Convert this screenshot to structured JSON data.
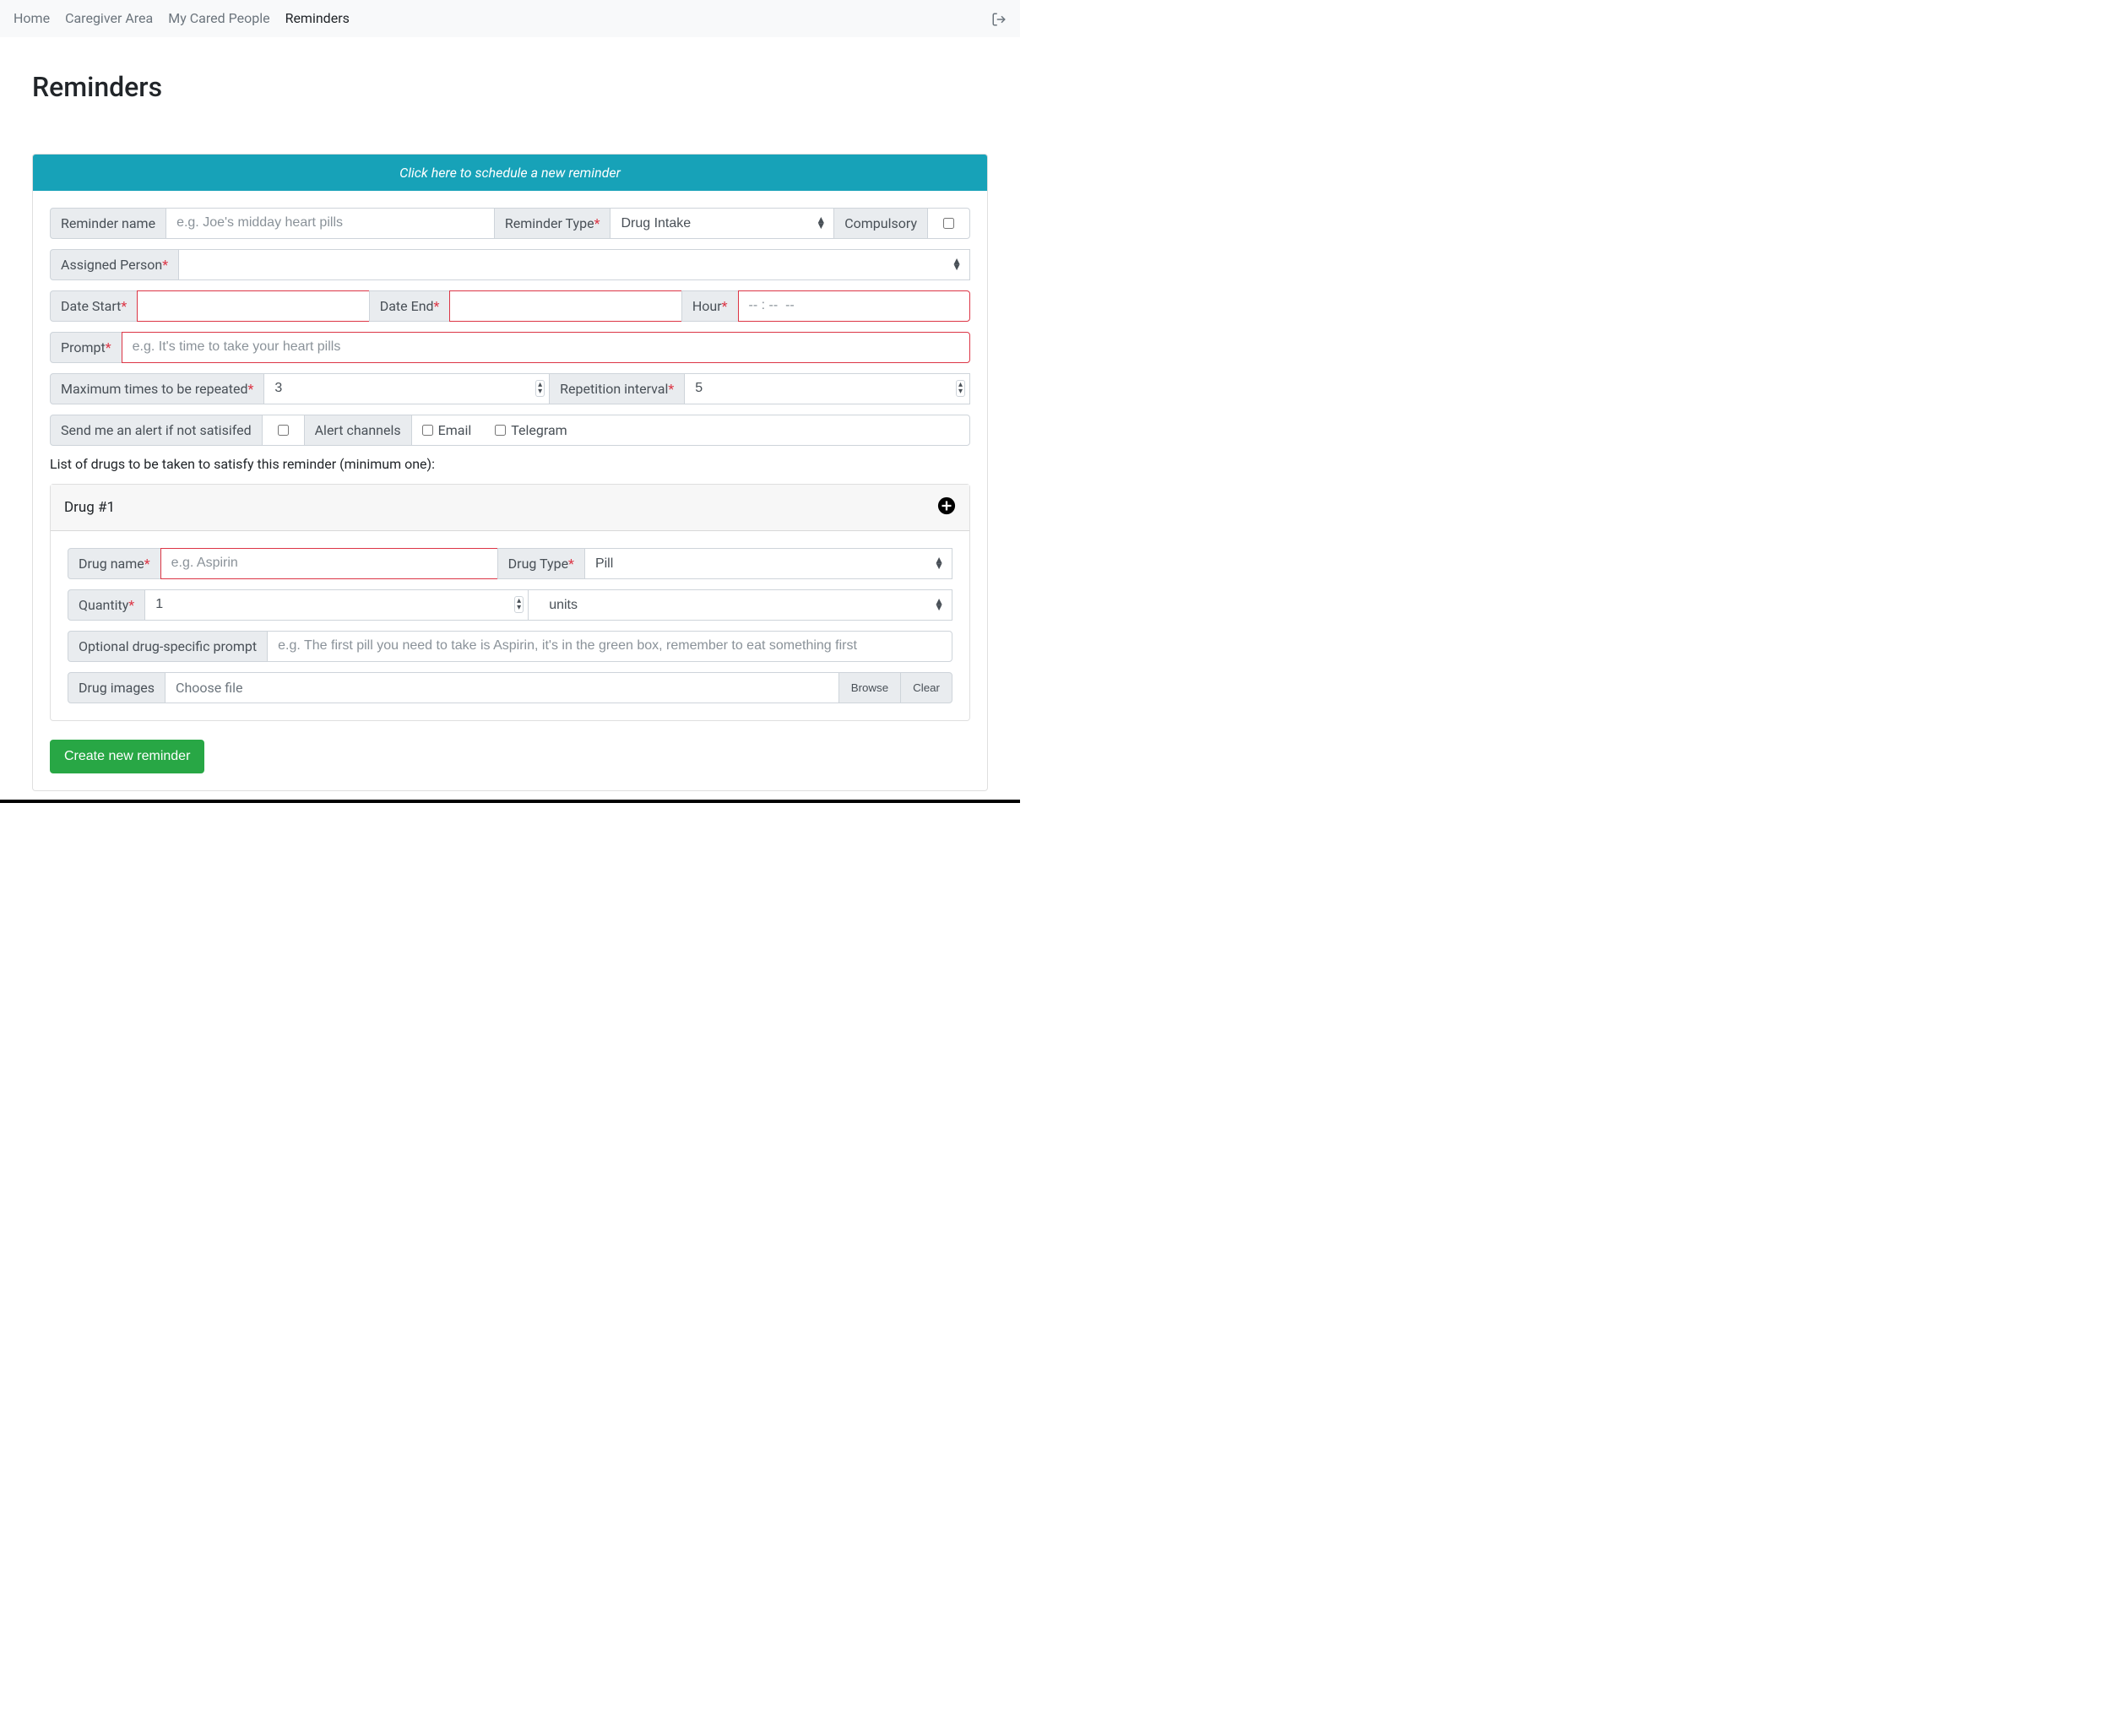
{
  "nav": {
    "items": [
      "Home",
      "Caregiver Area",
      "My Cared People",
      "Reminders"
    ],
    "active_index": 3
  },
  "page_title": "Reminders",
  "banner": "Click here to schedule a new reminder",
  "labels": {
    "reminder_name": "Reminder name",
    "reminder_type": "Reminder Type",
    "compulsory": "Compulsory",
    "assigned_person": "Assigned Person",
    "date_start": "Date Start",
    "date_end": "Date End",
    "hour": "Hour",
    "prompt": "Prompt",
    "max_repeated": "Maximum times to be repeated",
    "repetition_interval": "Repetition interval",
    "send_alert": "Send me an alert if not satisifed",
    "alert_channels": "Alert channels",
    "email": "Email",
    "telegram": "Telegram",
    "drugs_intro": "List of drugs to be taken to satisfy this reminder (minimum one):",
    "drug_section": "Drug #1",
    "drug_name": "Drug name",
    "drug_type": "Drug Type",
    "quantity": "Quantity",
    "units": "units",
    "optional_prompt": "Optional drug-specific prompt",
    "drug_images": "Drug images",
    "choose_file": "Choose file",
    "browse": "Browse",
    "clear": "Clear",
    "submit": "Create new reminder"
  },
  "placeholders": {
    "reminder_name": "e.g. Joe's midday heart pills",
    "prompt": "e.g. It's time to take your heart pills",
    "hour": "-- : --  --",
    "drug_name": "e.g. Aspirin",
    "optional_prompt": "e.g. The first pill you need to take is Aspirin, it's in the green box, remember to eat something first"
  },
  "values": {
    "reminder_type": "Drug Intake",
    "assigned_person": "",
    "max_repeated": "3",
    "repetition_interval": "5",
    "drug_type": "Pill",
    "quantity": "1",
    "units_select": "units"
  },
  "colors": {
    "banner_bg": "#17a2b8",
    "required": "#dc3545",
    "submit_bg": "#28a745"
  }
}
